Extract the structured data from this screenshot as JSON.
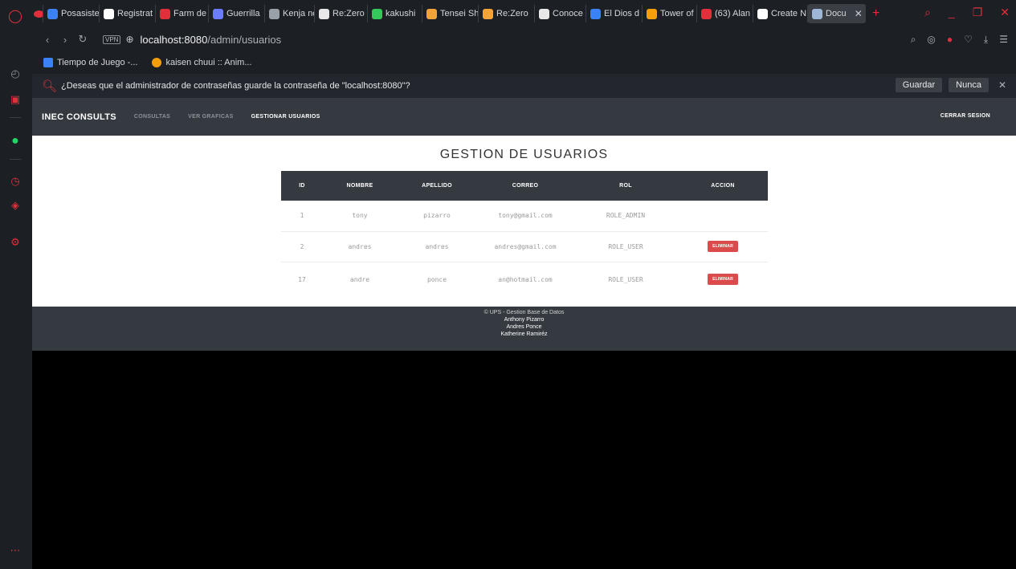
{
  "browser": {
    "tabs": [
      {
        "label": "Posasiste",
        "color": "#3b82f6"
      },
      {
        "label": "Registrat",
        "color": "#ffffff"
      },
      {
        "label": "Farm de",
        "color": "#e0303c"
      },
      {
        "label": "Guerrilla",
        "color": "#6b7cff"
      },
      {
        "label": "Kenja no",
        "color": "#9aa0a8"
      },
      {
        "label": "Re:Zero",
        "color": "#e8e8e8"
      },
      {
        "label": "kakushi",
        "color": "#34c759"
      },
      {
        "label": "Tensei Sh",
        "color": "#f2a33a"
      },
      {
        "label": "Re:Zero",
        "color": "#f2a33a"
      },
      {
        "label": "Conoce",
        "color": "#e8e8e8"
      },
      {
        "label": "El Dios d",
        "color": "#3b82f6"
      },
      {
        "label": "Tower of",
        "color": "#f59e0b"
      },
      {
        "label": "(63) Alan",
        "color": "#e0303c"
      },
      {
        "label": "Create N",
        "color": "#ffffff"
      },
      {
        "label": "Docu",
        "color": "#9fb7d6"
      }
    ],
    "url_host": "localhost:8080",
    "url_path": "/admin/usuarios",
    "vpn_label": "VPN",
    "bookmarks": [
      {
        "label": "Tiempo de Juego -...",
        "color": "#3b82f6"
      },
      {
        "label": "kaisen chuui :: Anim...",
        "color": "#f59e0b"
      }
    ],
    "password_prompt": {
      "message": "¿Deseas que el administrador de contraseñas guarde la contraseña de \"localhost:8080\"?",
      "save_label": "Guardar",
      "never_label": "Nunca"
    }
  },
  "app": {
    "brand": "INEC CONSULTS",
    "nav": {
      "consultas": "CONSULTAS",
      "graficas": "VER GRAFICAS",
      "usuarios": "GESTIONAR USUARIOS",
      "logout": "CERRAR SESION"
    },
    "title": "GESTION DE USUARIOS",
    "table": {
      "headers": [
        "ID",
        "NOMBRE",
        "APELLIDO",
        "CORREO",
        "ROL",
        "ACCION"
      ],
      "rows": [
        {
          "id": "1",
          "nombre": "tony",
          "apellido": "pizarro",
          "correo": "tony@gmail.com",
          "rol": "ROLE_ADMIN",
          "accion": ""
        },
        {
          "id": "2",
          "nombre": "andres",
          "apellido": "andres",
          "correo": "andres@gmail.com",
          "rol": "ROLE_USER",
          "accion": "ELIMINAR"
        },
        {
          "id": "17",
          "nombre": "andre",
          "apellido": "ponce",
          "correo": "an@hotmail.com",
          "rol": "ROLE_USER",
          "accion": "ELIMINAR"
        }
      ]
    },
    "footer": {
      "copyright": "© UPS - Gestion Base de Datos",
      "authors": [
        "Anthony Pizarro",
        "Andres Ponce",
        "Katherine Ramiréz"
      ]
    }
  }
}
